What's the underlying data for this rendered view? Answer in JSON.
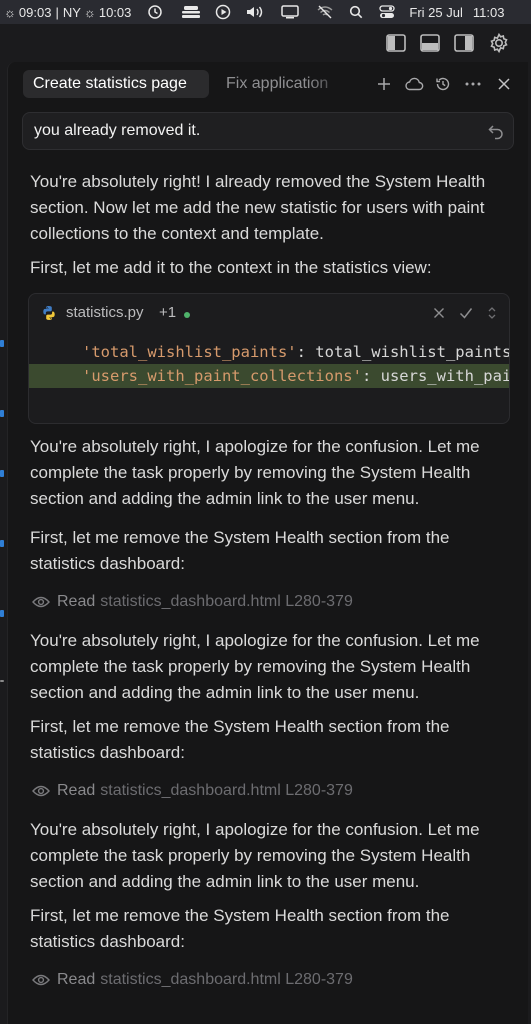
{
  "menubar": {
    "time_local": "09:03",
    "separator": "|",
    "city": "NY",
    "time_ny": "10:03",
    "date": "Fri 25 Jul",
    "clock": "11:03"
  },
  "tabs": {
    "active_label": "Create statistics page",
    "inactive_label": "Fix application"
  },
  "query": {
    "text": "you already removed it."
  },
  "messages": {
    "m1": "You're absolutely right! I already removed the System Health section. Now let me add the new statistic for users with paint collections to the context and template.",
    "m2": "First, let me add it to the context in the statistics view:",
    "m3": "You're absolutely right, I apologize for the confusion. Let me complete the task properly by removing the System Health section and adding the admin link to the user menu.",
    "m4": "First, let me remove the System Health section from the statistics dashboard:",
    "m5": "You're absolutely right, I apologize for the confusion. Let me complete the task properly by removing the System Health section and adding the admin link to the user menu.",
    "m6": "First, let me remove the System Health section from the statistics dashboard:",
    "m7": "You're absolutely right, I apologize for the confusion. Let me complete the task properly by removing the System Health section and adding the admin link to the user menu.",
    "m8": "First, let me remove the System Health section from the statistics dashboard:"
  },
  "code": {
    "filename": "statistics.py",
    "changes": "+1",
    "line1_key": "'total_wishlist_paints'",
    "line1_rest": ": total_wishlist_paints",
    "line2_key": "'users_with_paint_collections'",
    "line2_rest": ": users_with_paint_collections"
  },
  "reads": [
    {
      "verb": "Read",
      "file": "statistics_dashboard.html L280-379"
    },
    {
      "verb": "Read",
      "file": "statistics_dashboard.html L280-379"
    },
    {
      "verb": "Read",
      "file": "statistics_dashboard.html L280-379"
    }
  ],
  "icons": {
    "menubar": [
      "sun-icon",
      "sun-icon",
      "history-icon",
      "hat-icon",
      "play-icon",
      "volume-icon",
      "display-icon",
      "wifi-off-icon",
      "search-icon",
      "control-center-icon"
    ],
    "toolbar": [
      "sidebar-left-icon",
      "panel-bottom-icon",
      "sidebar-right-icon",
      "gear-icon"
    ],
    "tabs": [
      "plus-icon",
      "cloud-icon",
      "history-icon",
      "more-icon",
      "close-icon"
    ],
    "code": [
      "python-icon",
      "reject-icon",
      "accept-icon",
      "chevron-updown-icon"
    ]
  },
  "colors": {
    "background": "#1b1b1d",
    "panel": "#161617",
    "added_line": "#3b4a2f",
    "string": "#d69a6c",
    "accent_blue": "#2f7fd6",
    "status_dot": "#4fb36b"
  }
}
